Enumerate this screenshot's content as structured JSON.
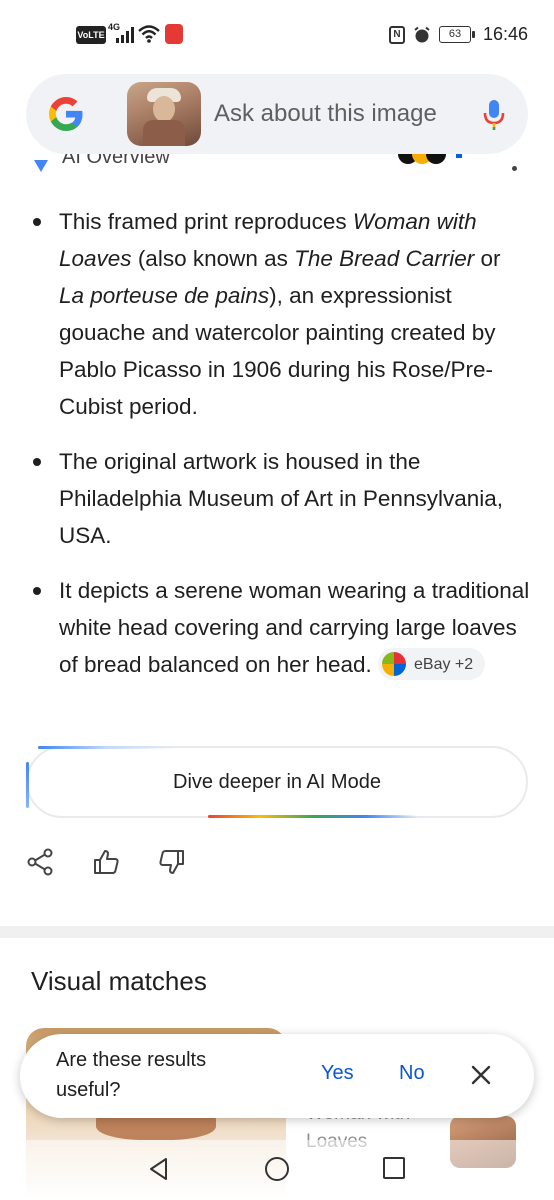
{
  "status_bar": {
    "volte": "VoLTE",
    "network": "4G",
    "battery": "63",
    "time": "16:46"
  },
  "search": {
    "placeholder": "Ask about this image"
  },
  "overview": {
    "label": "AI Overview"
  },
  "bullets": [
    {
      "parts": [
        {
          "t": "This framed print reproduces "
        },
        {
          "t": "Woman with Loaves",
          "i": true
        },
        {
          "t": " (also known as "
        },
        {
          "t": "The Bread Carrier",
          "i": true
        },
        {
          "t": " or "
        },
        {
          "t": "La porteuse de pains",
          "i": true
        },
        {
          "t": "), an expressionist gouache and watercolor painting created by Pablo Picasso in 1906 during his Rose/Pre-Cubist period."
        }
      ]
    },
    {
      "parts": [
        {
          "t": "The original artwork is housed in the Philadelphia Museum of Art in Pennsylvania, USA."
        }
      ]
    },
    {
      "parts": [
        {
          "t": "It depicts a serene woman wearing a traditional white head covering and carrying large loaves of bread balanced on her head."
        }
      ],
      "source_chip": "eBay +2"
    }
  ],
  "dive_deeper": "Dive deeper in AI Mode",
  "actions": {
    "share": "share-icon",
    "thumbs_up": "thumbs-up-icon",
    "thumbs_down": "thumbs-down-icon"
  },
  "visual_matches": {
    "title": "Visual matches",
    "right_card_title": "Woman with Loaves"
  },
  "feedback": {
    "question": "Are these results useful?",
    "yes": "Yes",
    "no": "No"
  },
  "colors": {
    "accent_blue": "#0b57d0",
    "search_bg": "#f0f2f5"
  }
}
